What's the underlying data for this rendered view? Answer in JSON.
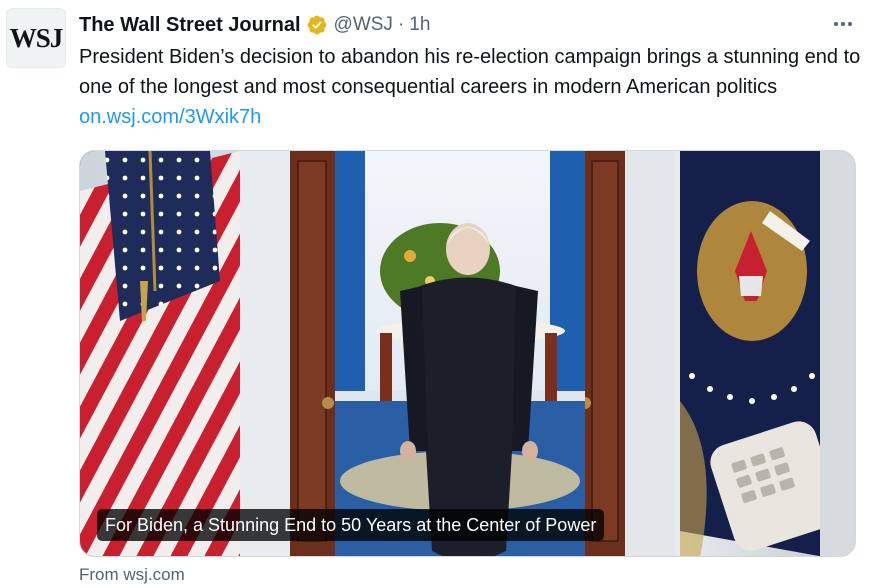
{
  "account": {
    "avatar_text": "WSJ",
    "name": "The Wall Street Journal",
    "handle": "@WSJ",
    "separator": "·",
    "time": "1h",
    "verified_icon": "gold-verified-badge-icon"
  },
  "tweet": {
    "text": "President Biden’s decision to abandon his re-election campaign brings a stunning end to one of the longest and most consequential careers in modern American politics",
    "link_text": "on.wsj.com/3Wxik7h"
  },
  "card": {
    "caption": "For Biden, a Stunning End to 50 Years at the Center of Power",
    "source": "From wsj.com"
  },
  "colors": {
    "link": "#1d9bf0",
    "secondary_text": "#536471",
    "verified_gold": "#e2b719"
  }
}
